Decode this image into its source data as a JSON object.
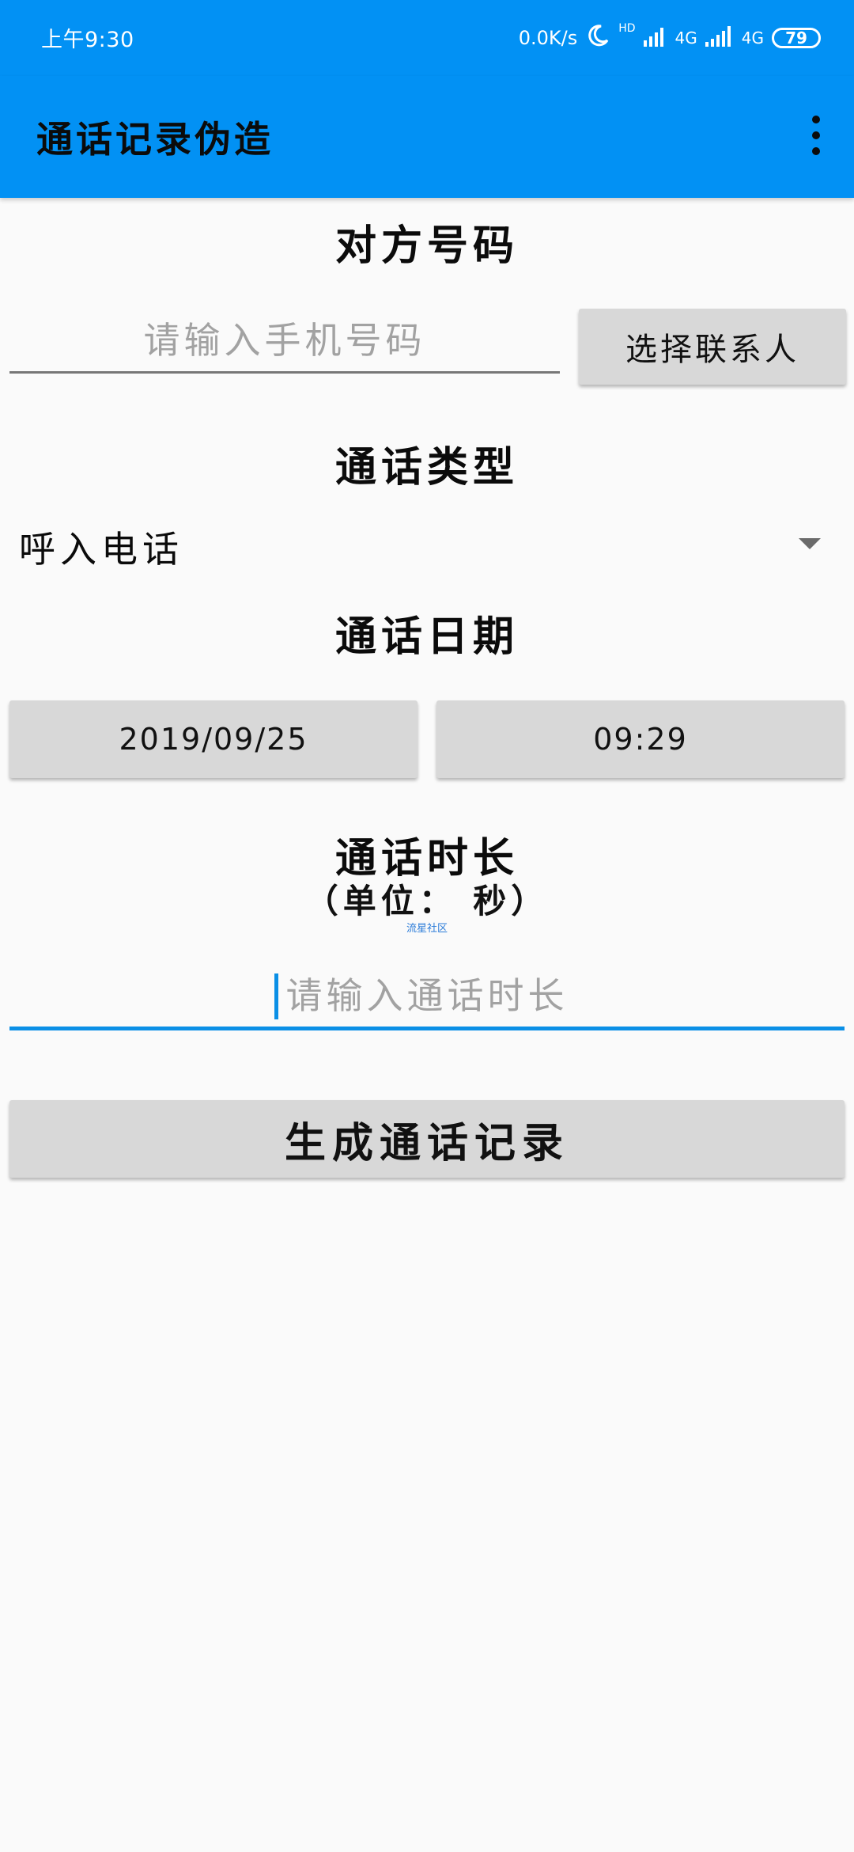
{
  "status_bar": {
    "time": "上午9:30",
    "net_speed": "0.0K/s",
    "hd_label": "HD",
    "network_1": "4G",
    "network_2": "4G",
    "battery": "79",
    "icons": [
      "moon-icon",
      "signal-icon",
      "signal-icon"
    ]
  },
  "app_bar": {
    "title": "通话记录伪造",
    "menu_icon": "more-vert-icon"
  },
  "phone_section": {
    "title": "对方号码",
    "placeholder": "请输入手机号码",
    "value": "",
    "select_contact_label": "选择联系人"
  },
  "call_type_section": {
    "title": "通话类型",
    "selected": "呼入电话"
  },
  "date_section": {
    "title": "通话日期",
    "date": "2019/09/25",
    "time": "09:29"
  },
  "duration_section": {
    "title": "通话时长",
    "unit_label": "（单位： 秒）",
    "watermark": "流星社区",
    "placeholder": "请输入通话时长",
    "value": ""
  },
  "actions": {
    "generate_label": "生成通话记录"
  },
  "colors": {
    "primary": "#0291f4",
    "accent": "#0a8fe6",
    "button": "#d8d8d8",
    "background": "#fafafa"
  }
}
